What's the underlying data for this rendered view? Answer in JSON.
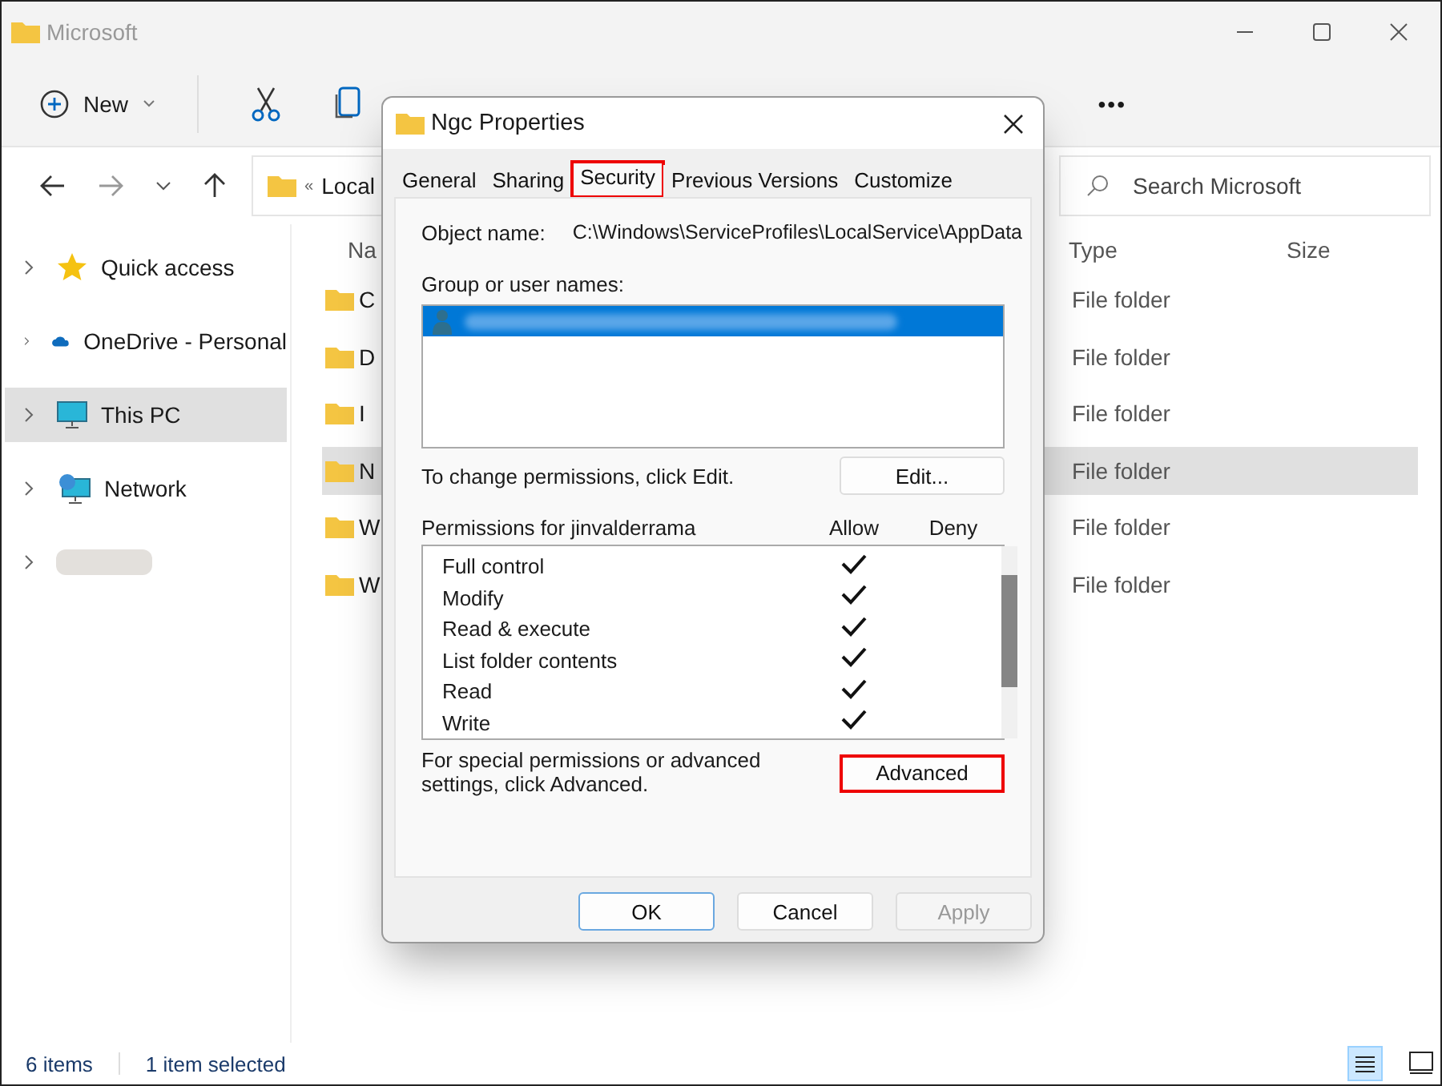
{
  "window": {
    "title": "Microsoft"
  },
  "toolbar": {
    "new_label": "New",
    "more": "•••"
  },
  "address": {
    "prefix": "«",
    "path": "Local"
  },
  "search": {
    "placeholder": "Search Microsoft"
  },
  "sidebar": {
    "items": [
      {
        "label": "Quick access",
        "selected": false
      },
      {
        "label": "OneDrive - Personal",
        "selected": false
      },
      {
        "label": "This PC",
        "selected": true
      },
      {
        "label": "Network",
        "selected": false
      },
      {
        "selected": false
      }
    ]
  },
  "files": {
    "columns": [
      "Na",
      "Type",
      "Size"
    ],
    "rows": [
      {
        "name": "C",
        "type": "File folder",
        "selected": false
      },
      {
        "name": "D",
        "type": "File folder",
        "selected": false
      },
      {
        "name": "I",
        "type": "File folder",
        "selected": false
      },
      {
        "name": "N",
        "type": "File folder",
        "selected": true
      },
      {
        "name": "W",
        "type": "File folder",
        "selected": false
      },
      {
        "name": "W",
        "type": "File folder",
        "selected": false
      }
    ]
  },
  "status_bar": {
    "count": "6 items",
    "selection": "1 item selected"
  },
  "dialog": {
    "title": "Ngc Properties",
    "tabs": [
      {
        "label": "General",
        "selected": false,
        "highlighted": false
      },
      {
        "label": "Sharing",
        "selected": false,
        "highlighted": false
      },
      {
        "label": "Security",
        "selected": true,
        "highlighted": true
      },
      {
        "label": "Previous Versions",
        "selected": false,
        "highlighted": false
      },
      {
        "label": "Customize",
        "selected": false,
        "highlighted": false
      }
    ],
    "object_label": "Object name:",
    "object_value": "C:\\Windows\\ServiceProfiles\\LocalService\\AppData",
    "group_label": "Group or user names:",
    "change_text": "To change permissions, click Edit.",
    "edit_button": "Edit...",
    "permissions_label": "Permissions for jinvalderrama",
    "allow_label": "Allow",
    "deny_label": "Deny",
    "permissions": [
      {
        "name": "Full control",
        "allow": true,
        "deny": false
      },
      {
        "name": "Modify",
        "allow": true,
        "deny": false
      },
      {
        "name": "Read & execute",
        "allow": true,
        "deny": false
      },
      {
        "name": "List folder contents",
        "allow": true,
        "deny": false
      },
      {
        "name": "Read",
        "allow": true,
        "deny": false
      },
      {
        "name": "Write",
        "allow": true,
        "deny": false
      }
    ],
    "advanced_text": "For special permissions or advanced settings, click Advanced.",
    "advanced_button": {
      "label": "Advanced",
      "highlighted": true
    },
    "buttons": [
      {
        "label": "OK",
        "kind": "default",
        "disabled": false
      },
      {
        "label": "Cancel",
        "kind": "normal",
        "disabled": false
      },
      {
        "label": "Apply",
        "kind": "normal",
        "disabled": true
      }
    ]
  }
}
